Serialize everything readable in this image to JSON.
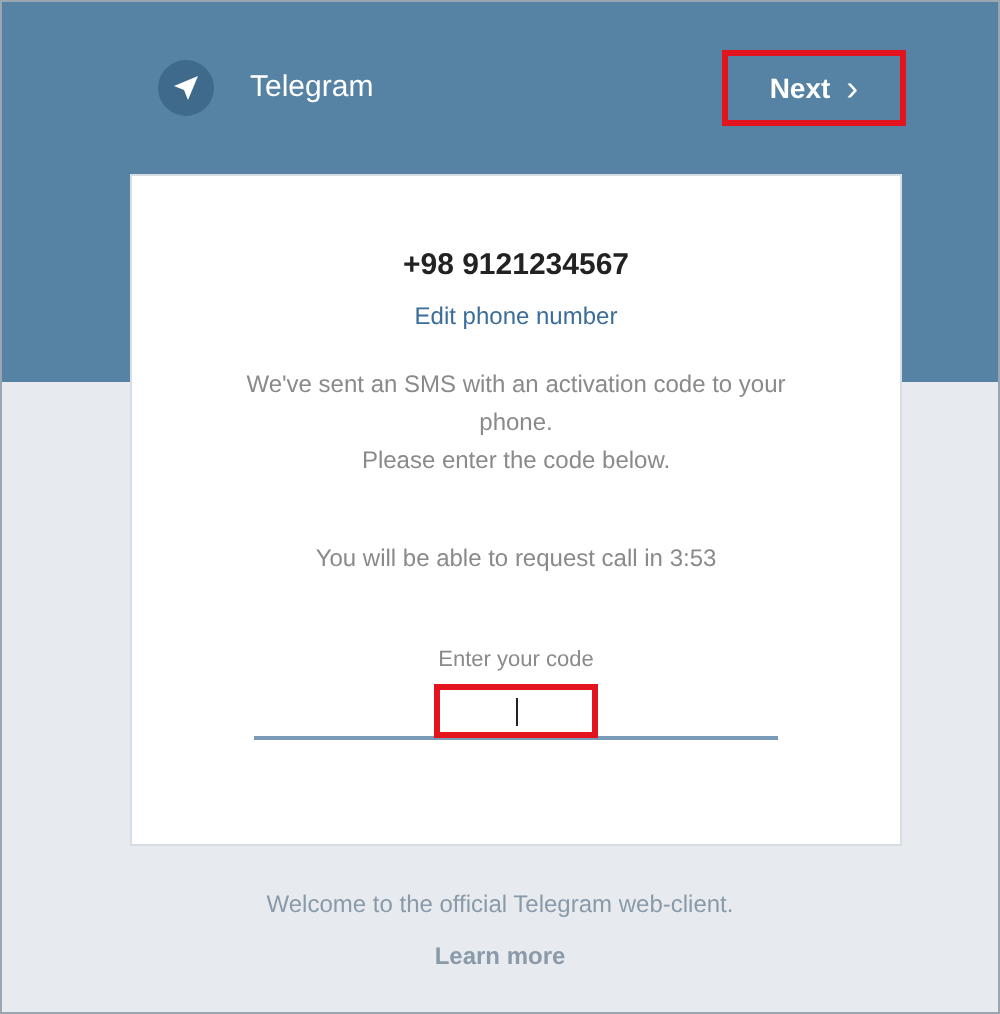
{
  "header": {
    "title": "Telegram",
    "next_button": {
      "label": "Next",
      "icon": "›",
      "highlighted": true
    }
  },
  "card": {
    "phone": "+98 9121234567",
    "edit_link": "Edit phone number",
    "message_lines": [
      "We've sent an SMS with an activation code to your phone.",
      "Please enter the code below."
    ],
    "call_notice": "You will be able to request call in 3:53",
    "code_field": {
      "label": "Enter your code",
      "highlighted": true
    }
  },
  "footer": {
    "welcome": "Welcome to the official Telegram web-client.",
    "learn_more": "Learn more"
  }
}
